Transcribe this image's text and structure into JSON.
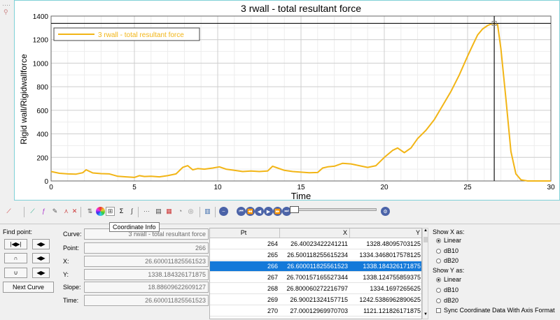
{
  "window": {
    "handle": "····"
  },
  "chart_data": {
    "type": "line",
    "title": "3 rwall - total resultant force",
    "xlabel": "Time",
    "ylabel": "Rigid wall/Rigidwallforce",
    "xlim": [
      0,
      30
    ],
    "ylim": [
      0,
      1400
    ],
    "xticks": [
      "0",
      "5",
      "10",
      "15",
      "20",
      "25",
      "30"
    ],
    "yticks": [
      "0",
      "200",
      "400",
      "600",
      "800",
      "1000",
      "1200",
      "1400"
    ],
    "grid": true,
    "legend": "top-left",
    "series": [
      {
        "name": "3 rwall - total resultant force",
        "color": "#f2b516",
        "x": [
          0,
          0.5,
          1,
          1.5,
          1.9,
          2.1,
          2.5,
          3,
          3.5,
          4,
          4.5,
          5,
          5.3,
          5.6,
          6,
          6.5,
          7,
          7.5,
          7.9,
          8.2,
          8.5,
          8.8,
          9.2,
          9.7,
          10.1,
          10.5,
          11,
          11.5,
          12,
          12.5,
          13,
          13.3,
          13.6,
          14,
          14.5,
          15,
          15.5,
          16,
          16.3,
          16.6,
          17,
          17.5,
          18,
          18.5,
          19,
          19.5,
          20,
          20.5,
          20.8,
          21.2,
          21.6,
          22,
          22.5,
          23,
          23.5,
          24,
          24.5,
          25,
          25.3,
          25.6,
          25.9,
          26.2,
          26.4,
          26.6,
          26.8,
          27,
          27.3,
          27.6,
          27.9,
          28.2,
          28.6,
          29,
          30
        ],
        "y": [
          80,
          65,
          60,
          58,
          70,
          95,
          68,
          62,
          60,
          40,
          35,
          30,
          45,
          38,
          40,
          35,
          45,
          60,
          115,
          130,
          95,
          105,
          100,
          110,
          120,
          100,
          90,
          80,
          85,
          80,
          85,
          125,
          110,
          90,
          80,
          75,
          70,
          72,
          110,
          120,
          125,
          150,
          145,
          130,
          115,
          130,
          200,
          260,
          280,
          240,
          280,
          360,
          430,
          520,
          640,
          760,
          900,
          1060,
          1150,
          1240,
          1290,
          1320,
          1332,
          1338,
          1330,
          1121,
          700,
          250,
          60,
          10,
          0,
          0,
          0
        ]
      }
    ],
    "crosshair": {
      "x": 26.600011825561523,
      "y": 1338.184326171875
    }
  },
  "toolbar": {
    "tooltip": "Coordinate Info",
    "icons": [
      "curve-style-icon",
      "curve-add-icon",
      "math-fx-icon",
      "curve-edit-icon",
      "fft-icon",
      "delete-curve-icon",
      "curve-order-icon",
      "color-wheel-icon",
      "coordinate-info-icon",
      "sigma-icon",
      "integrate-icon",
      "grid-icon",
      "table-icon",
      "report-icon",
      "comment-icon",
      "camera-icon",
      "chart-settings-icon"
    ],
    "media": [
      "⏮",
      "⏪",
      "◀",
      "▶",
      "⏩",
      "⏭"
    ]
  },
  "find_point": {
    "label": "Find point:",
    "buttons": [
      "|◀",
      "▶|",
      "◀",
      "▶",
      "∩",
      "◀",
      "▶",
      "∪",
      "◀",
      "▶"
    ],
    "next_curve": "Next Curve"
  },
  "fields": [
    {
      "label": "Curve:",
      "value": "3 rwall - total resultant force"
    },
    {
      "label": "Point:",
      "value": "266"
    },
    {
      "label": "X:",
      "value": "26.600011825561523"
    },
    {
      "label": "Y:",
      "value": "1338.184326171875"
    },
    {
      "label": "Slope:",
      "value": "18.88609622609127"
    },
    {
      "label": "Time:",
      "value": "26.600011825561523"
    }
  ],
  "table": {
    "headers": [
      "Pt",
      "X",
      "Y"
    ],
    "rows": [
      [
        "264",
        "26.40023422241211",
        "1328.48095703125"
      ],
      [
        "265",
        "26.500118255615234",
        "1334.3468017578125"
      ],
      [
        "266",
        "26.600011825561523",
        "1338.184326171875"
      ],
      [
        "267",
        "26.700157165527344",
        "1338.124755859375"
      ],
      [
        "268",
        "26.800060272216797",
        "1334.1697265625"
      ],
      [
        "269",
        "26.90021324157715",
        "1242.5386962890625"
      ],
      [
        "270",
        "27.00012969970703",
        "1121.121826171875"
      ]
    ],
    "selected_row": 2
  },
  "options": {
    "show_x_label": "Show X as:",
    "show_x": [
      "Linear",
      "dB10",
      "dB20"
    ],
    "show_y_label": "Show Y as:",
    "show_y": [
      "Linear",
      "dB10",
      "dB20"
    ],
    "sync_label": "Sync Coordinate Data With Axis Format"
  }
}
